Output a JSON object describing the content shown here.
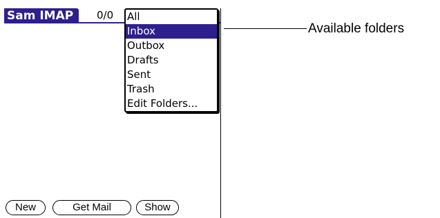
{
  "titlebar": {
    "app_title": "Sam IMAP",
    "message_count": "0/0"
  },
  "folders": {
    "items": [
      "All",
      "Inbox",
      "Outbox",
      "Drafts",
      "Sent",
      "Trash",
      "Edit Folders..."
    ],
    "selected": "Inbox"
  },
  "buttons": {
    "new_label": "New",
    "get_mail_label": "Get Mail",
    "show_label": "Show"
  },
  "callout": {
    "label": "Available folders"
  },
  "colors": {
    "highlight": "#2e1f8f"
  }
}
